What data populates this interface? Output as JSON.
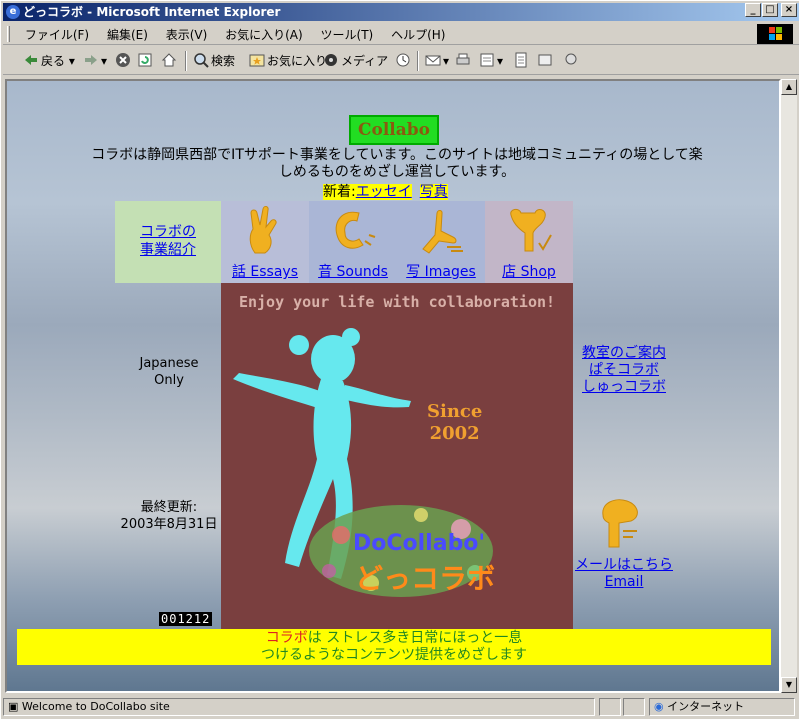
{
  "window": {
    "title": "どっコラボ - Microsoft Internet Explorer",
    "buttons": {
      "minimize": "_",
      "maximize": "□",
      "close": "×"
    }
  },
  "menu": [
    "ファイル(F)",
    "編集(E)",
    "表示(V)",
    "お気に入り(A)",
    "ツール(T)",
    "ヘルプ(H)"
  ],
  "toolbar": {
    "back": "戻る",
    "search": "検索",
    "favorites": "お気に入り",
    "media": "メディア"
  },
  "page": {
    "logo_text": "Collabo",
    "intro": "コラボは静岡県西部でITサポート事業をしています。このサイトは地域コミュニティの場として楽しめるものをめざし運営しています。",
    "news_label": "新着:",
    "news_links": [
      "エッセイ",
      "写真"
    ],
    "nav": {
      "intro_link_line1": "コラボの",
      "intro_link_line2": "事業紹介",
      "items": [
        {
          "label": "話 Essays",
          "icon": "hand-peace-icon"
        },
        {
          "label": "音 Sounds",
          "icon": "ear-icon"
        },
        {
          "label": "写 Images",
          "icon": "camera-hand-icon"
        },
        {
          "label": "店 Shop",
          "icon": "shop-figure-icon"
        }
      ]
    },
    "hero": {
      "tagline": "Enjoy your life with collaboration!",
      "since_line1": "Since",
      "since_line2": "2002",
      "brand_line1": "DoCollabo'",
      "brand_line2": "どっコラボ"
    },
    "left_side": {
      "language_line1": "Japanese",
      "language_line2": "Only",
      "updated_label": "最終更新:",
      "updated_date": "2003年8月31日"
    },
    "right_side": {
      "classes": [
        "教室のご案内",
        "ぱそコラボ",
        "しゅっコラボ"
      ],
      "mail": "メールはこちら",
      "email": "Email"
    },
    "counter": "001212",
    "banner": {
      "brand": "コラボ",
      "line1_rest": "は ストレス多き日常にほっと一息",
      "line2": "つけるようなコンテンツ提供をめざします"
    }
  },
  "status": {
    "message": "Welcome to DoCollabo site",
    "zone": "インターネット"
  },
  "colors": {
    "hero_bg": "#7a3f3f",
    "banner_bg": "#ffff00",
    "figure": "#66e8ee",
    "icon_gold": "#f0b020"
  }
}
